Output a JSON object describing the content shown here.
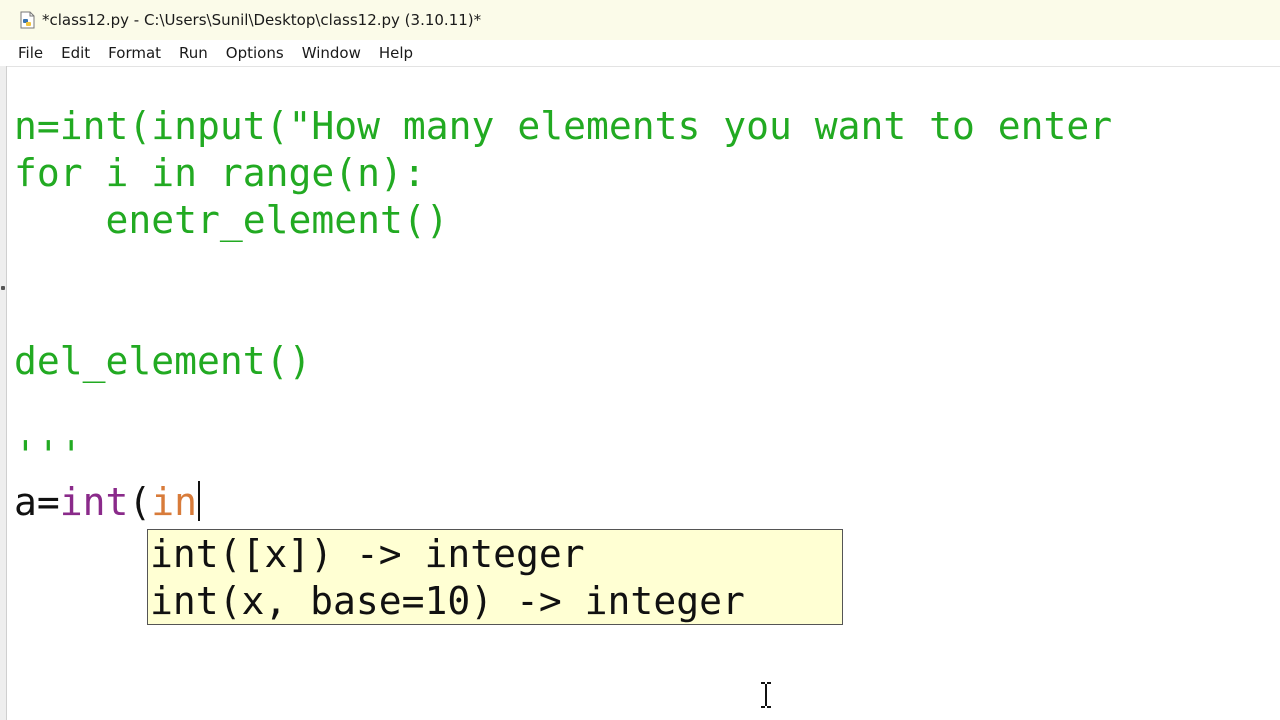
{
  "window": {
    "title": "*class12.py - C:\\Users\\Sunil\\Desktop\\class12.py (3.10.11)*",
    "icon": "python-file-icon"
  },
  "menu": {
    "items": [
      "File",
      "Edit",
      "Format",
      "Run",
      "Options",
      "Window",
      "Help"
    ]
  },
  "editor": {
    "lines": [
      "n=int(input(\"How many elements you want to enter",
      "for i in range(n):",
      "    enetr_element()",
      "",
      "",
      "del_element()",
      "",
      "'''",
      {
        "prefix": "a=",
        "builtin": "int",
        "paren": "(",
        "typed": "in"
      }
    ]
  },
  "calltip": {
    "lines": [
      "int([x]) -> integer",
      "int(x, base=10) -> integer"
    ]
  },
  "colors": {
    "string": "#22aa22",
    "builtin": "#8a2a8a",
    "typing": "#d87b3a",
    "calltip_bg": "#ffffd3",
    "titlebar_bg": "#fbfbe9"
  },
  "cursor": "i-beam-cursor-icon"
}
